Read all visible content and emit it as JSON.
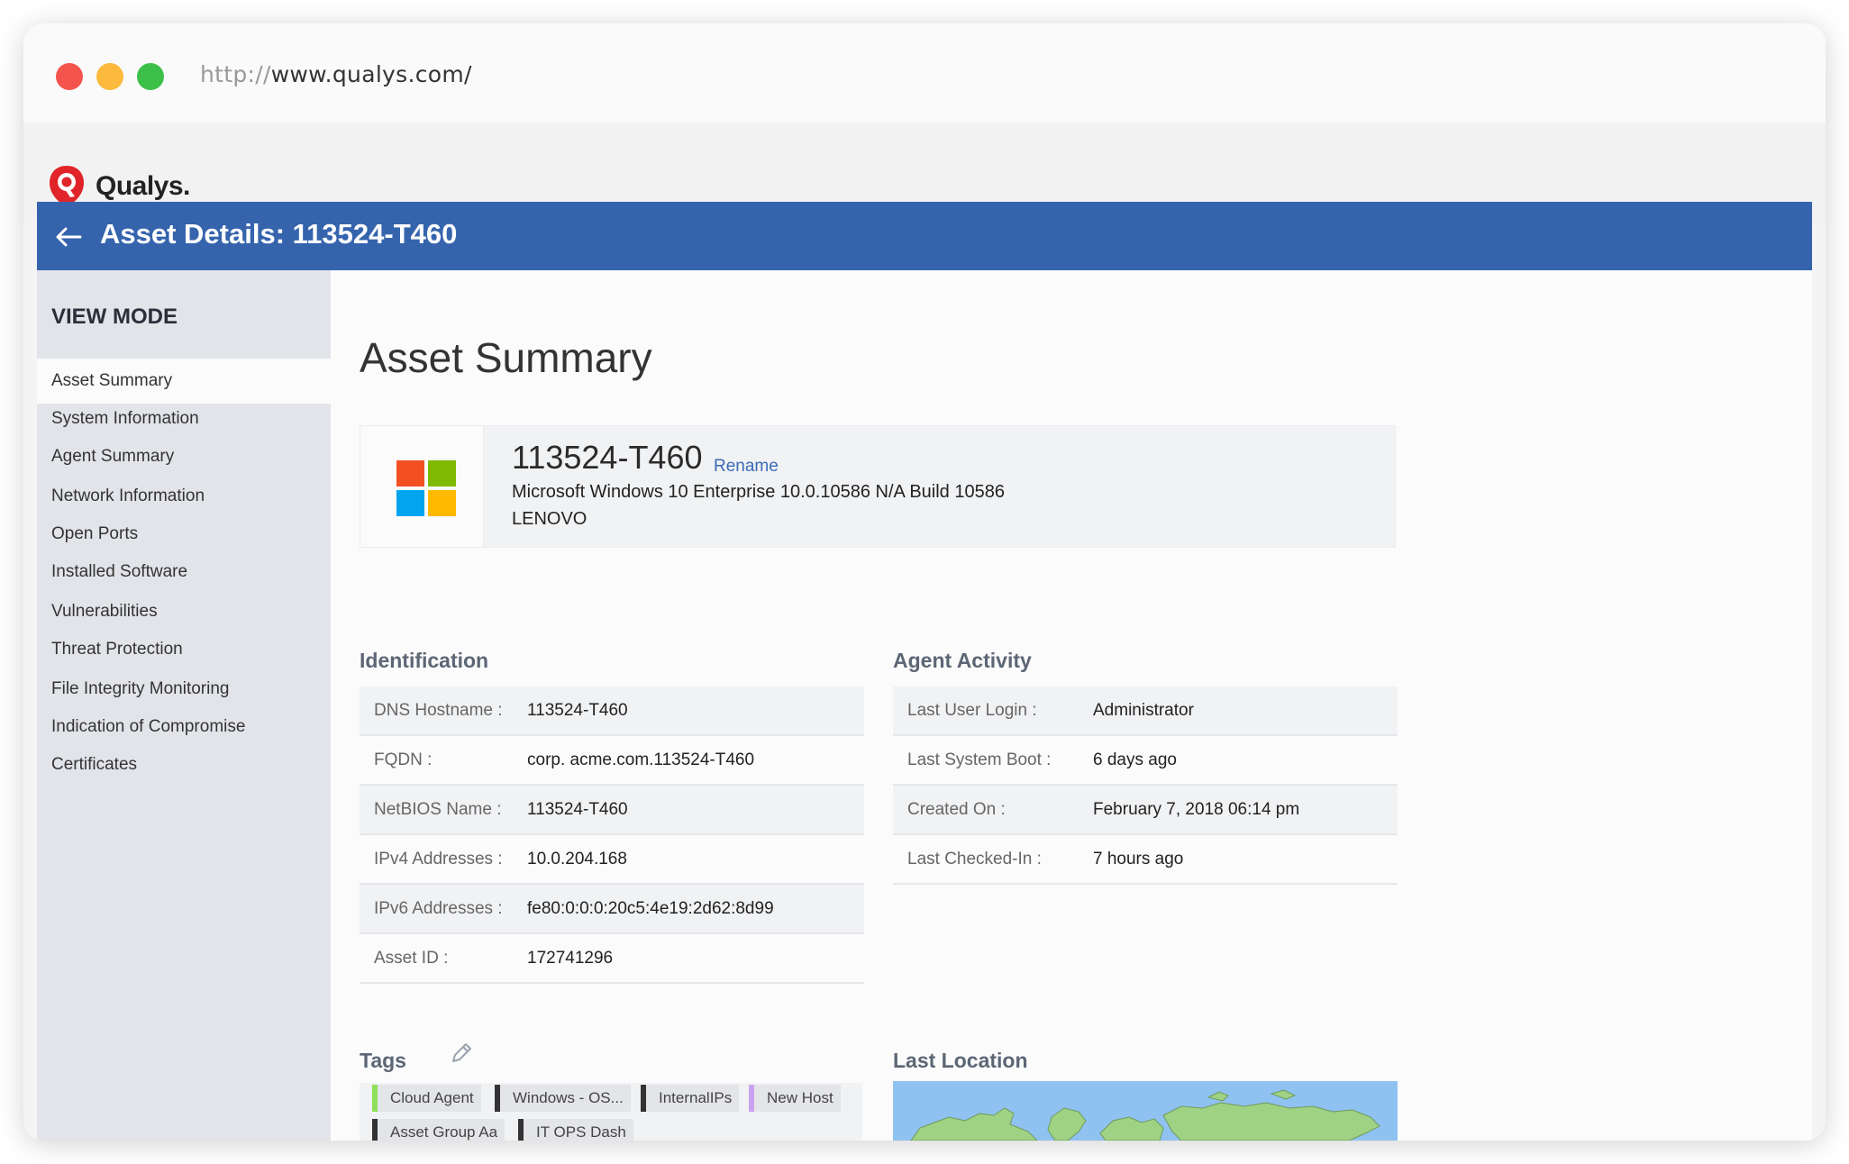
{
  "browser": {
    "url_protocol": "http://",
    "url_host": "www.qualys.com/"
  },
  "brand": {
    "name": "Qualys."
  },
  "header": {
    "title": "Asset Details: 113524-T460"
  },
  "sidebar": {
    "heading": "VIEW MODE",
    "items": [
      {
        "label": "Asset Summary",
        "active": true
      },
      {
        "label": "System Information"
      },
      {
        "label": "Agent Summary"
      },
      {
        "label": "Network Information"
      },
      {
        "label": "Open Ports"
      },
      {
        "label": "Installed Software"
      },
      {
        "label": "Vulnerabilities"
      },
      {
        "label": "Threat Protection"
      },
      {
        "label": "File Integrity Monitoring"
      },
      {
        "label": "Indication of Compromise"
      },
      {
        "label": "Certificates"
      }
    ]
  },
  "main": {
    "title": "Asset Summary",
    "asset": {
      "name": "113524-T460",
      "rename_label": "Rename",
      "os": "Microsoft Windows 10 Enterprise 10.0.10586 N/A Build 10586",
      "vendor": "LENOVO",
      "os_icon": "windows-logo-icon"
    },
    "identification": {
      "title": "Identification",
      "rows": [
        {
          "label": "DNS Hostname :",
          "value": "113524-T460"
        },
        {
          "label": "FQDN :",
          "value": "corp. acme.com.113524-T460"
        },
        {
          "label": "NetBIOS Name :",
          "value": "113524-T460"
        },
        {
          "label": "IPv4 Addresses :",
          "value": "10.0.204.168"
        },
        {
          "label": "IPv6 Addresses :",
          "value": "fe80:0:0:0:20c5:4e19:2d62:8d99"
        },
        {
          "label": "Asset ID :",
          "value": "172741296"
        }
      ]
    },
    "agent_activity": {
      "title": "Agent Activity",
      "rows": [
        {
          "label": "Last User Login :",
          "value": "Administrator"
        },
        {
          "label": "Last System Boot :",
          "value": "6 days ago"
        },
        {
          "label": "Created On :",
          "value": "February 7, 2018 06:14 pm"
        },
        {
          "label": "Last Checked-In :",
          "value": "7 hours ago"
        }
      ]
    },
    "tags": {
      "title": "Tags",
      "items": [
        {
          "label": "Cloud Agent",
          "color": "#8ee05a"
        },
        {
          "label": "Windows - OS...",
          "color": "#333333"
        },
        {
          "label": "InternalIPs",
          "color": "#333333"
        },
        {
          "label": "New Host",
          "color": "#c9a3f0"
        },
        {
          "label": "Asset Group Aa",
          "color": "#333333"
        },
        {
          "label": "IT OPS Dash",
          "color": "#333333"
        }
      ]
    },
    "last_location": {
      "title": "Last Location"
    }
  },
  "colors": {
    "header_blue": "#3564ad",
    "link_blue": "#3a6ab6",
    "sidebar_bg": "#e2e4e9"
  }
}
